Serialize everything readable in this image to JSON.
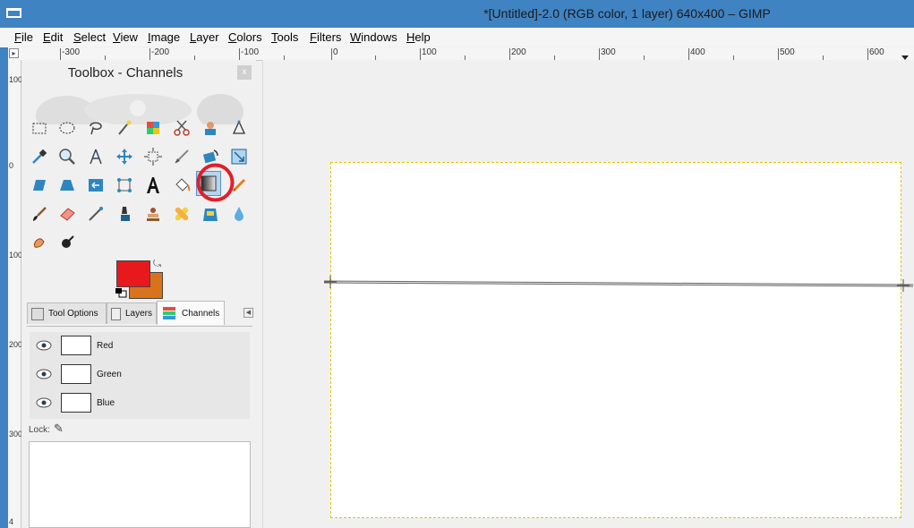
{
  "window": {
    "title": "*[Untitled]-2.0 (RGB color, 1 layer) 640x400 – GIMP"
  },
  "menu": [
    {
      "label": "File"
    },
    {
      "label": "Edit"
    },
    {
      "label": "Select"
    },
    {
      "label": "View"
    },
    {
      "label": "Image"
    },
    {
      "label": "Layer"
    },
    {
      "label": "Colors"
    },
    {
      "label": "Tools"
    },
    {
      "label": "Filters"
    },
    {
      "label": "Windows"
    },
    {
      "label": "Help"
    }
  ],
  "hruler": {
    "labels": [
      "-300",
      "-200",
      "-100",
      "0",
      "100",
      "200",
      "300",
      "400",
      "500",
      "600"
    ]
  },
  "vruler": {
    "labels": [
      "100",
      "0",
      "100",
      "200",
      "300",
      "4"
    ]
  },
  "dock": {
    "title": "Toolbox - Channels",
    "close": "x",
    "colors": {
      "foreground": "#e8191c",
      "background": "#d9731b"
    },
    "tabs": [
      {
        "label": "Tool Options"
      },
      {
        "label": "Layers"
      },
      {
        "label": "Channels"
      }
    ],
    "channels": [
      {
        "name": "Red"
      },
      {
        "name": "Green"
      },
      {
        "name": "Blue"
      }
    ],
    "lock_label": "Lock:"
  },
  "tools": {
    "active": "blend-tool",
    "highlight_color": "#e0202a"
  }
}
